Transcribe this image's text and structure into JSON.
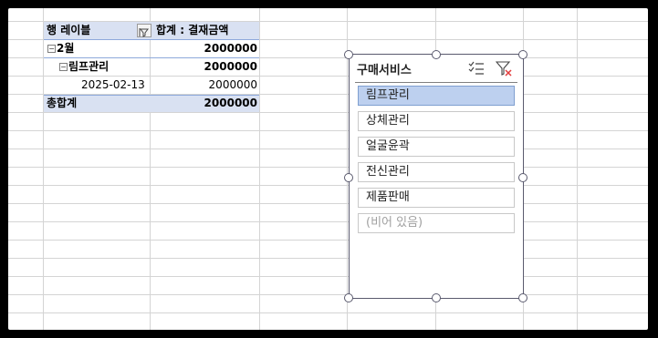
{
  "pivot": {
    "row_label_header": "행 레이블",
    "value_header": "합계 : 결재금액",
    "rows": [
      {
        "label": "2월",
        "value": "2000000",
        "toggle": "−"
      },
      {
        "label": "림프관리",
        "value": "2000000",
        "toggle": "−"
      },
      {
        "label": "2025-02-13",
        "value": "2000000"
      }
    ],
    "grand_total": {
      "label": "총합계",
      "value": "2000000"
    }
  },
  "slicer": {
    "title": "구매서비스",
    "items": [
      {
        "label": "림프관리",
        "selected": true
      },
      {
        "label": "상체관리",
        "selected": false
      },
      {
        "label": "얼굴윤곽",
        "selected": false
      },
      {
        "label": "전신관리",
        "selected": false
      },
      {
        "label": "제품판매",
        "selected": false
      },
      {
        "label": "(비어 있음)",
        "selected": false
      }
    ]
  },
  "colors": {
    "header_band": "#d9e1f2",
    "selected_item": "#bdd0ef",
    "gridline": "#d4d4d4",
    "clear_filter_x": "#e23c3c"
  },
  "icons": [
    "filter-dropdown-icon",
    "multi-select-icon",
    "clear-filter-icon"
  ]
}
